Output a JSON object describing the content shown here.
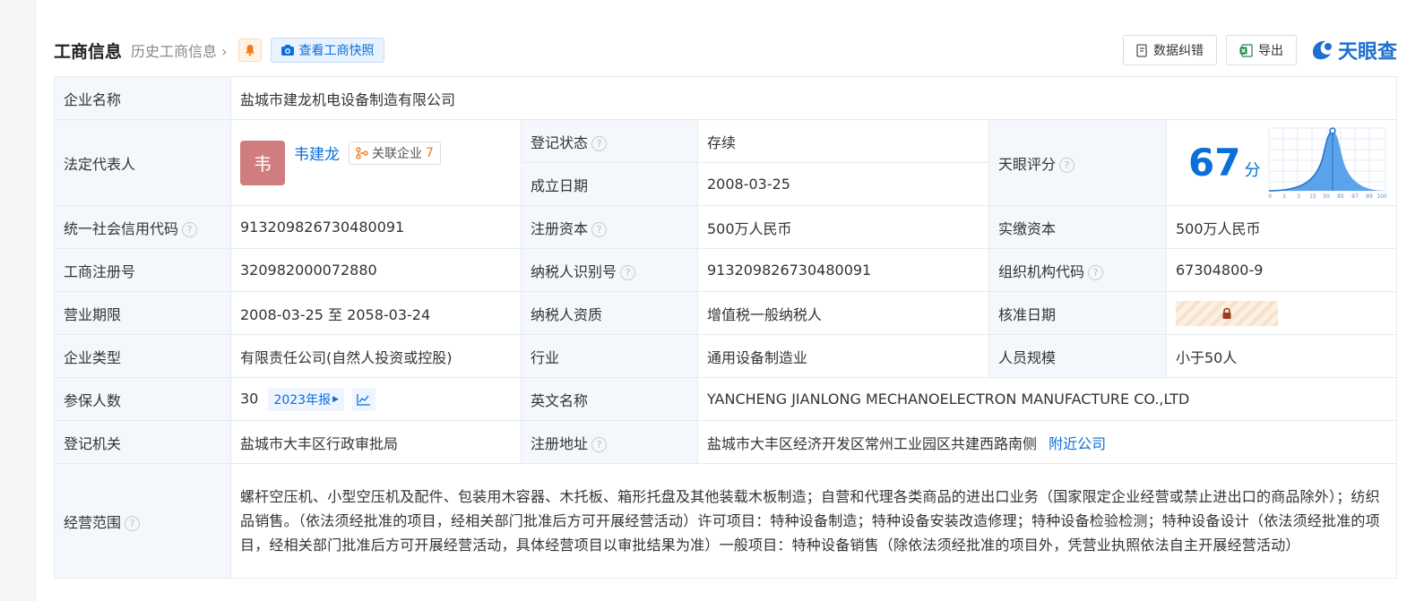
{
  "header": {
    "title": "工商信息",
    "history": "历史工商信息",
    "snapshot": "查看工商快照",
    "correct_btn": "数据纠错",
    "export_btn": "导出",
    "logo_text": "天眼查"
  },
  "rows": {
    "company_name": {
      "label": "企业名称",
      "value": "盐城市建龙机电设备制造有限公司"
    },
    "legal_rep": {
      "label": "法定代表人",
      "avatar": "韦",
      "name": "韦建龙",
      "related_label": "关联企业",
      "related_count": "7"
    },
    "reg_status": {
      "label": "登记状态",
      "value": "存续"
    },
    "founded": {
      "label": "成立日期",
      "value": "2008-03-25"
    },
    "score": {
      "label": "天眼评分",
      "value": "67",
      "unit": "分",
      "ticks": [
        "0",
        "1",
        "3",
        "15",
        "50",
        "85",
        "97",
        "99",
        "100"
      ]
    },
    "credit_code": {
      "label": "统一社会信用代码",
      "value": "913209826730480091"
    },
    "reg_capital": {
      "label": "注册资本",
      "value": "500万人民币"
    },
    "paid_capital": {
      "label": "实缴资本",
      "value": "500万人民币"
    },
    "reg_no": {
      "label": "工商注册号",
      "value": "320982000072880"
    },
    "taxpayer_id": {
      "label": "纳税人识别号",
      "value": "913209826730480091"
    },
    "org_code": {
      "label": "组织机构代码",
      "value": "67304800-9"
    },
    "term": {
      "label": "营业期限",
      "value": "2008-03-25 至 2058-03-24"
    },
    "taxpayer_type": {
      "label": "纳税人资质",
      "value": "增值税一般纳税人"
    },
    "approve_date": {
      "label": "核准日期"
    },
    "company_type": {
      "label": "企业类型",
      "value": "有限责任公司(自然人投资或控股)"
    },
    "industry": {
      "label": "行业",
      "value": "通用设备制造业"
    },
    "staff_size": {
      "label": "人员规模",
      "value": "小于50人"
    },
    "insured": {
      "label": "参保人数",
      "value": "30",
      "report": "2023年报"
    },
    "english_name": {
      "label": "英文名称",
      "value": "YANCHENG JIANLONG MECHANOELECTRON MANUFACTURE CO.,LTD"
    },
    "reg_authority": {
      "label": "登记机关",
      "value": "盐城市大丰区行政审批局"
    },
    "reg_address": {
      "label": "注册地址",
      "value": "盐城市大丰区经济开发区常州工业园区共建西路南侧",
      "nearby": "附近公司"
    },
    "scope": {
      "label": "经营范围",
      "value": "螺杆空压机、小型空压机及配件、包装用木容器、木托板、箱形托盘及其他装载木板制造；自营和代理各类商品的进出口业务（国家限定企业经营或禁止进出口的商品除外）；纺织品销售。（依法须经批准的项目，经相关部门批准后方可开展经营活动）许可项目：特种设备制造；特种设备安装改造修理；特种设备检验检测；特种设备设计（依法须经批准的项目，经相关部门批准后方可开展经营活动，具体经营项目以审批结果为准）一般项目：特种设备销售（除依法须经批准的项目外，凭营业执照依法自主开展经营活动）"
    }
  },
  "colors": {
    "accent": "#0a6fd8",
    "status_green": "#1a9b42",
    "label_bg": "#f4f8fc"
  }
}
